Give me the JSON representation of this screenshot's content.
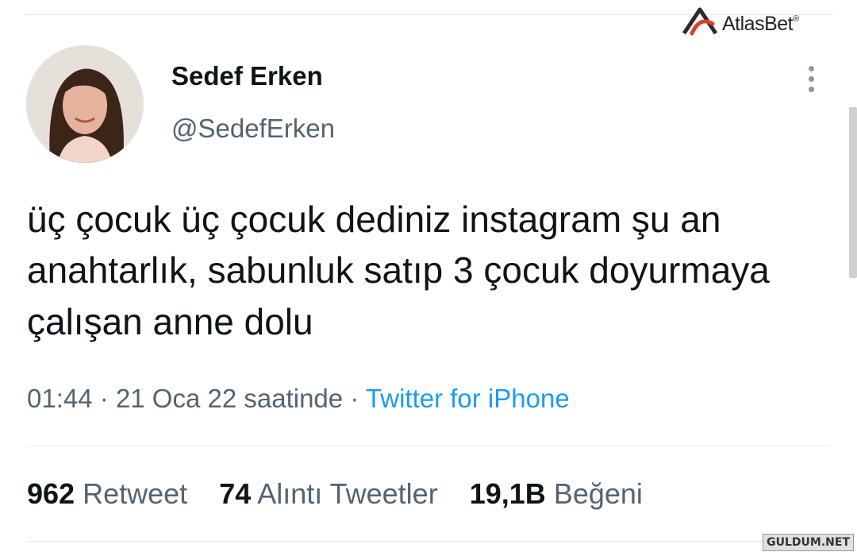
{
  "watermark": {
    "brand": "AtlasBet",
    "registered": "®"
  },
  "tweet": {
    "author_name": "Sedef Erken",
    "author_handle": "@SedefErken",
    "text": "üç çocuk üç çocuk dediniz instagram şu an anahtarlık, sabunluk satıp 3 çocuk doyurmaya çalışan anne dolu",
    "time": "01:44",
    "date": "21 Oca 22 saatinde",
    "separator": "·",
    "source": "Twitter for iPhone"
  },
  "stats": [
    {
      "count": "962",
      "label": "Retweet"
    },
    {
      "count": "74",
      "label": "Alıntı Tweetler"
    },
    {
      "count": "19,1B",
      "label": "Beğeni"
    }
  ],
  "footer_watermark": "GULDUM.NET",
  "icons": {
    "more": "more-vertical-icon",
    "brand_logo": "atlasbet-logo-icon"
  },
  "colors": {
    "link": "#1d9bf0",
    "secondary_text": "#536471",
    "primary_text": "#0f1419",
    "brand_red": "#d4402b"
  }
}
